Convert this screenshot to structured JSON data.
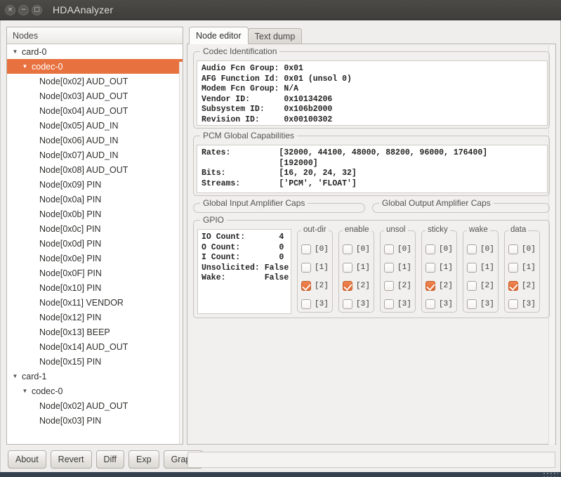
{
  "window": {
    "title": "HDAAnalyzer",
    "close_label": "×",
    "minimize_label": "−",
    "maximize_label": "□"
  },
  "nodes_panel": {
    "header": "Nodes",
    "collapse_glyph": "▼",
    "items": [
      {
        "label": "card-0",
        "level": 0,
        "expander": "▼",
        "selected": false
      },
      {
        "label": "codec-0",
        "level": 1,
        "expander": "▼",
        "selected": true
      },
      {
        "label": "Node[0x02] AUD_OUT",
        "level": 2,
        "expander": "",
        "selected": false
      },
      {
        "label": "Node[0x03] AUD_OUT",
        "level": 2,
        "expander": "",
        "selected": false
      },
      {
        "label": "Node[0x04] AUD_OUT",
        "level": 2,
        "expander": "",
        "selected": false
      },
      {
        "label": "Node[0x05] AUD_IN",
        "level": 2,
        "expander": "",
        "selected": false
      },
      {
        "label": "Node[0x06] AUD_IN",
        "level": 2,
        "expander": "",
        "selected": false
      },
      {
        "label": "Node[0x07] AUD_IN",
        "level": 2,
        "expander": "",
        "selected": false
      },
      {
        "label": "Node[0x08] AUD_OUT",
        "level": 2,
        "expander": "",
        "selected": false
      },
      {
        "label": "Node[0x09] PIN",
        "level": 2,
        "expander": "",
        "selected": false
      },
      {
        "label": "Node[0x0a] PIN",
        "level": 2,
        "expander": "",
        "selected": false
      },
      {
        "label": "Node[0x0b] PIN",
        "level": 2,
        "expander": "",
        "selected": false
      },
      {
        "label": "Node[0x0c] PIN",
        "level": 2,
        "expander": "",
        "selected": false
      },
      {
        "label": "Node[0x0d] PIN",
        "level": 2,
        "expander": "",
        "selected": false
      },
      {
        "label": "Node[0x0e] PIN",
        "level": 2,
        "expander": "",
        "selected": false
      },
      {
        "label": "Node[0x0F] PIN",
        "level": 2,
        "expander": "",
        "selected": false
      },
      {
        "label": "Node[0x10] PIN",
        "level": 2,
        "expander": "",
        "selected": false
      },
      {
        "label": "Node[0x11] VENDOR",
        "level": 2,
        "expander": "",
        "selected": false
      },
      {
        "label": "Node[0x12] PIN",
        "level": 2,
        "expander": "",
        "selected": false
      },
      {
        "label": "Node[0x13] BEEP",
        "level": 2,
        "expander": "",
        "selected": false
      },
      {
        "label": "Node[0x14] AUD_OUT",
        "level": 2,
        "expander": "",
        "selected": false
      },
      {
        "label": "Node[0x15] PIN",
        "level": 2,
        "expander": "",
        "selected": false
      },
      {
        "label": "card-1",
        "level": 0,
        "expander": "▼",
        "selected": false
      },
      {
        "label": "codec-0",
        "level": 1,
        "expander": "▼",
        "selected": false
      },
      {
        "label": "Node[0x02] AUD_OUT",
        "level": 2,
        "expander": "",
        "selected": false
      },
      {
        "label": "Node[0x03] PIN",
        "level": 2,
        "expander": "",
        "selected": false
      }
    ]
  },
  "buttons": [
    {
      "label": "About"
    },
    {
      "label": "Revert"
    },
    {
      "label": "Diff"
    },
    {
      "label": "Exp"
    },
    {
      "label": "Graph"
    }
  ],
  "tabs": [
    {
      "label": "Node editor",
      "active": true
    },
    {
      "label": "Text dump",
      "active": false
    }
  ],
  "codec_identification": {
    "legend": "Codec Identification",
    "text": "Audio Fcn Group: 0x01\nAFG Function Id: 0x01 (unsol 0)\nModem Fcn Group: N/A\nVendor ID:       0x10134206\nSubsystem ID:    0x106b2000\nRevision ID:     0x00100302"
  },
  "pcm_global_capabilities": {
    "legend": "PCM Global Capabilities",
    "text": "Rates:          [32000, 44100, 48000, 88200, 96000, 176400]\n                [192000]\nBits:           [16, 20, 24, 32]\nStreams:        ['PCM', 'FLOAT']"
  },
  "global_input_amplifier_caps": {
    "legend": "Global Input Amplifier Caps"
  },
  "global_output_amplifier_caps": {
    "legend": "Global Output Amplifier Caps"
  },
  "gpio": {
    "legend": "GPIO",
    "info_text": "IO Count:       4\nO Count:        0\nI Count:        0\nUnsolicited: False\nWake:        False",
    "columns": [
      {
        "legend": "out-dir",
        "checks": [
          {
            "label": "[0]",
            "checked": false
          },
          {
            "label": "[1]",
            "checked": false
          },
          {
            "label": "[2]",
            "checked": true
          },
          {
            "label": "[3]",
            "checked": false
          }
        ]
      },
      {
        "legend": "enable",
        "checks": [
          {
            "label": "[0]",
            "checked": false
          },
          {
            "label": "[1]",
            "checked": false
          },
          {
            "label": "[2]",
            "checked": true
          },
          {
            "label": "[3]",
            "checked": false
          }
        ]
      },
      {
        "legend": "unsol",
        "checks": [
          {
            "label": "[0]",
            "checked": false
          },
          {
            "label": "[1]",
            "checked": false
          },
          {
            "label": "[2]",
            "checked": false
          },
          {
            "label": "[3]",
            "checked": false
          }
        ]
      },
      {
        "legend": "sticky",
        "checks": [
          {
            "label": "[0]",
            "checked": false
          },
          {
            "label": "[1]",
            "checked": false
          },
          {
            "label": "[2]",
            "checked": true
          },
          {
            "label": "[3]",
            "checked": false
          }
        ]
      },
      {
        "legend": "wake",
        "checks": [
          {
            "label": "[0]",
            "checked": false
          },
          {
            "label": "[1]",
            "checked": false
          },
          {
            "label": "[2]",
            "checked": false
          },
          {
            "label": "[3]",
            "checked": false
          }
        ]
      },
      {
        "legend": "data",
        "checks": [
          {
            "label": "[0]",
            "checked": false
          },
          {
            "label": "[1]",
            "checked": false
          },
          {
            "label": "[2]",
            "checked": true
          },
          {
            "label": "[3]",
            "checked": false
          }
        ]
      }
    ]
  },
  "colors": {
    "selection_orange": "#e8723f",
    "titlebar": "#3f3e3a",
    "panel_bg": "#f1f0ee"
  }
}
